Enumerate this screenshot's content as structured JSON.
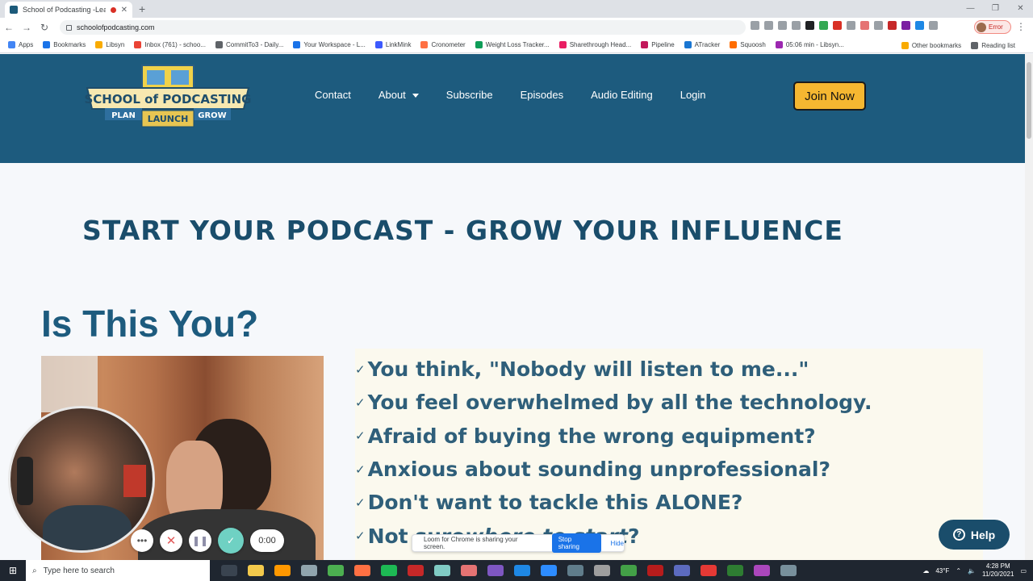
{
  "browser": {
    "tab_title": "School of Podcasting -Learn",
    "url": "schoolofpodcasting.com",
    "profile_status": "Error",
    "bookmarks": [
      {
        "label": "Apps",
        "color": "#4285f4"
      },
      {
        "label": "Bookmarks",
        "color": "#1a73e8"
      },
      {
        "label": "Libsyn",
        "color": "#f9ab00"
      },
      {
        "label": "Inbox (761) - schoo...",
        "color": "#ea4335"
      },
      {
        "label": "CommitTo3 - Daily...",
        "color": "#5f6368"
      },
      {
        "label": "Your Workspace - L...",
        "color": "#1a73e8"
      },
      {
        "label": "LinkMink",
        "color": "#3d5afe"
      },
      {
        "label": "Cronometer",
        "color": "#ff7043"
      },
      {
        "label": "Weight Loss Tracker...",
        "color": "#0f9d58"
      },
      {
        "label": "Sharethrough Head...",
        "color": "#e91e63"
      },
      {
        "label": "Pipeline",
        "color": "#c2185b"
      },
      {
        "label": "ATracker",
        "color": "#1976d2"
      },
      {
        "label": "Squoosh",
        "color": "#ff6d00"
      },
      {
        "label": "05:06 min - Libsyn...",
        "color": "#9c27b0"
      }
    ],
    "other_bookmarks": "Other bookmarks",
    "reading_list": "Reading list"
  },
  "site": {
    "logo": {
      "line1": "SCHOOL of PODCASTING",
      "plan": "PLAN",
      "launch": "LAUNCH",
      "grow": "GROW"
    },
    "nav": {
      "contact": "Contact",
      "about": "About",
      "subscribe": "Subscribe",
      "episodes": "Episodes",
      "audio_editing": "Audio Editing",
      "login": "Login"
    },
    "cta": "Join Now",
    "hero": "START YOUR PODCAST - GROW YOUR INFLUENCE",
    "question_title": "Is This You?",
    "checklist": [
      "You think, \"Nobody will listen to me...\"",
      "You feel overwhelmed by all the technology.",
      "Afraid of buying the wrong equipment?",
      "Anxious about sounding unprofessional?",
      "Don't want to tackle this ALONE?"
    ],
    "checklist_last_prefix": "Not sure ",
    "checklist_last_em": "where to start",
    "checklist_last_suffix": "?",
    "help": "Help"
  },
  "loom": {
    "timer": "0:00",
    "share_message": "Loom for Chrome is sharing your screen.",
    "stop_sharing": "Stop sharing",
    "hide": "Hide"
  },
  "taskbar": {
    "search_placeholder": "Type here to search",
    "weather": "43°F",
    "time": "4:28 PM",
    "date": "11/20/2021"
  },
  "colors": {
    "header_bg": "#1d5b7e",
    "cta_bg": "#f5b731",
    "heading": "#1a4d6b",
    "checklist_text": "#2f5f7a"
  }
}
